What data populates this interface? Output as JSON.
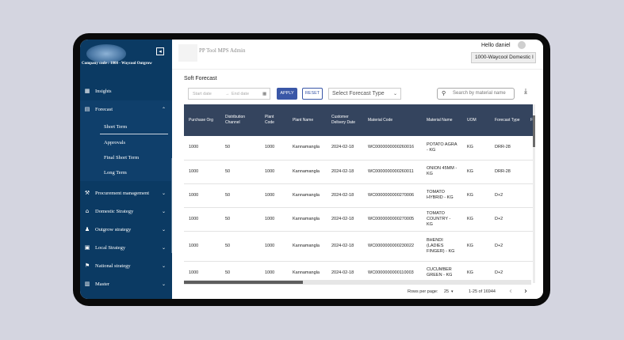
{
  "sidebar": {
    "company": "Company code : 1000 - Waycool Outgrow",
    "collapse_icon": "collapse-left-icon",
    "items": [
      {
        "label": "Insights",
        "icon": "dashboard-icon"
      },
      {
        "label": "Forecast",
        "icon": "forecast-icon"
      },
      {
        "label": "Procurement management",
        "icon": "hammer-icon"
      },
      {
        "label": "Domestic Strategy",
        "icon": "domestic-icon"
      },
      {
        "label": "Outgrow strategy",
        "icon": "people-icon"
      },
      {
        "label": "Local Strategy",
        "icon": "local-icon"
      },
      {
        "label": "National strategy",
        "icon": "national-icon"
      },
      {
        "label": "Master",
        "icon": "master-icon"
      }
    ],
    "forecast_subitems": [
      "Short Term",
      "Approvals",
      "Final Short Term",
      "Long Term"
    ],
    "active_subitem": "Short Term"
  },
  "header": {
    "app_title": "PP Tool MPS Admin",
    "greeting": "Hello daniel",
    "company_select": "1000-Waycool Domestic I"
  },
  "main": {
    "section_title": "Soft Forecast",
    "filters": {
      "start_placeholder": "Start date",
      "arrow": "→",
      "end_placeholder": "End date",
      "apply_label": "APPLY",
      "reset_label": "RESET",
      "forecast_type_placeholder": "Select Forecast Type",
      "search_placeholder": "Search by material name"
    },
    "table": {
      "headers": [
        "Purchase Org",
        "Distribution Channel",
        "Plant Code",
        "Plant Name",
        "Customer Delivery Date",
        "Material Code",
        "Material Name",
        "UOM",
        "Forecast Type",
        "F"
      ],
      "rows": [
        [
          "1000",
          "50",
          "1000",
          "Kannamangla",
          "2024-02-18",
          "WC0000000000260016",
          "POTATO AGRA - KG",
          "KG",
          "DRR-28",
          ""
        ],
        [
          "1000",
          "50",
          "1000",
          "Kannamangla",
          "2024-02-18",
          "WC0000000000260011",
          "ONION 45MM - KG",
          "KG",
          "DRR-28",
          ""
        ],
        [
          "1000",
          "50",
          "1000",
          "Kannamangla",
          "2024-02-18",
          "WC0000000000270006",
          "TOMATO HYBRID - KG",
          "KG",
          "D+2",
          ""
        ],
        [
          "1000",
          "50",
          "1000",
          "Kannamangla",
          "2024-02-18",
          "WC0000000000270005",
          "TOMATO COUNTRY - KG",
          "KG",
          "D+2",
          ""
        ],
        [
          "1000",
          "50",
          "1000",
          "Kannamangla",
          "2024-02-18",
          "WC0000000000230022",
          "BHENDI (LADIES FINGER) - KG",
          "KG",
          "D+2",
          ""
        ],
        [
          "1000",
          "50",
          "1000",
          "Kannamangla",
          "2024-02-18",
          "WC0000000000110003",
          "CUCUMBER GREEN - KG",
          "KG",
          "D+2",
          ""
        ]
      ]
    },
    "pagination": {
      "rows_per_page_label": "Rows per page:",
      "rows_per_page": "25",
      "range": "1-25 of 16944",
      "prev": "‹",
      "next": "›"
    }
  },
  "colors": {
    "sidebar": "#0b3a63",
    "table_header": "#34445e",
    "primary": "#3a57a7"
  }
}
